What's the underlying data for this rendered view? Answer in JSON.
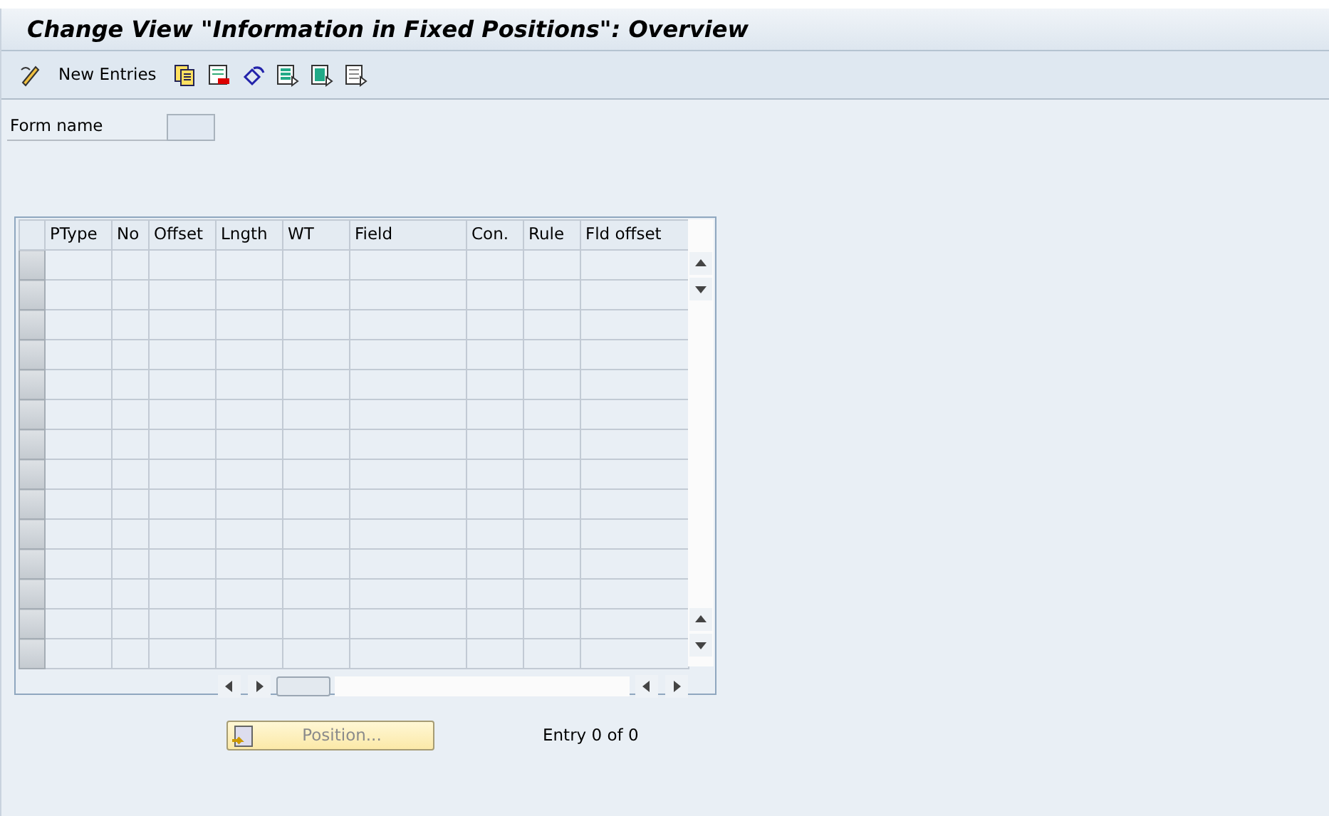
{
  "window": {
    "title": "Change View \"Information in Fixed Positions\": Overview"
  },
  "toolbar": {
    "new_entries": "New Entries"
  },
  "form_name": {
    "label": "Form name"
  },
  "table": {
    "columns": [
      "PType",
      "No",
      "Offset",
      "Lngth",
      "WT",
      "Field",
      "Con.",
      "Rule",
      "Fld offset"
    ]
  },
  "position_button": {
    "label": "Position...",
    "disabled": true
  },
  "entry_count": "Entry 0 of 0"
}
